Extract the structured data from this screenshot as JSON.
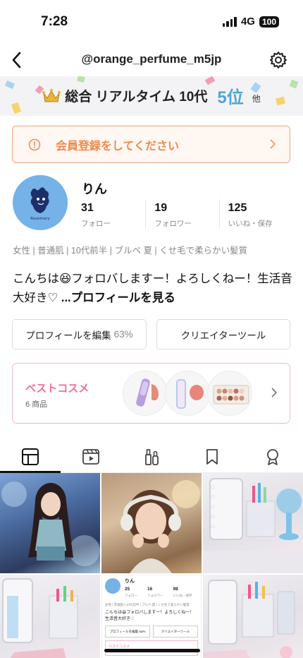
{
  "status": {
    "time": "7:28",
    "network": "4G",
    "battery": "100"
  },
  "header": {
    "title": "@orange_perfume_m5jp"
  },
  "ranking": {
    "label": "総合 リアルタイム 10代",
    "rank": "5位",
    "other": "他"
  },
  "register": {
    "label": "会員登録をしてください"
  },
  "profile": {
    "name": "りん",
    "avatar_text": "Rosemary",
    "stats": [
      {
        "value": "31",
        "label": "フォロー"
      },
      {
        "value": "19",
        "label": "フォロワー"
      },
      {
        "value": "125",
        "label": "いいね・保存"
      }
    ],
    "tags": "女性 | 普通肌 | 10代前半 | ブルベ 夏 | くせ毛で柔らかい髪質",
    "bio": "こんちは😆フォロバしますー！よろしくねー！生活音大好き♡ ",
    "bio_more": "...プロフィールを見る"
  },
  "buttons": {
    "edit": "プロフィールを編集",
    "edit_pct": "63%",
    "creator": "クリエイターツール"
  },
  "best": {
    "title": "ベストコスメ",
    "count": "6 商品"
  },
  "tabs": [
    "grid",
    "video",
    "cosme",
    "bookmark",
    "award"
  ],
  "mini_profile": {
    "name": "りん",
    "stats": [
      {
        "value": "25",
        "label": "フォロー"
      },
      {
        "value": "16",
        "label": "フォロワー"
      },
      {
        "value": "98",
        "label": "いいね・保存"
      }
    ],
    "tags": "女性 | 普通肌 | 10代前半 | ブルベ 夏 | くせ毛で柔らかい髪質",
    "bio": "こんちは😆フォロバしますー！よろしくねー！生活音大好き♡",
    "edit": "プロフィールを編集 63%",
    "creator": "クリエイターツール",
    "best": "ベストコスメ"
  }
}
